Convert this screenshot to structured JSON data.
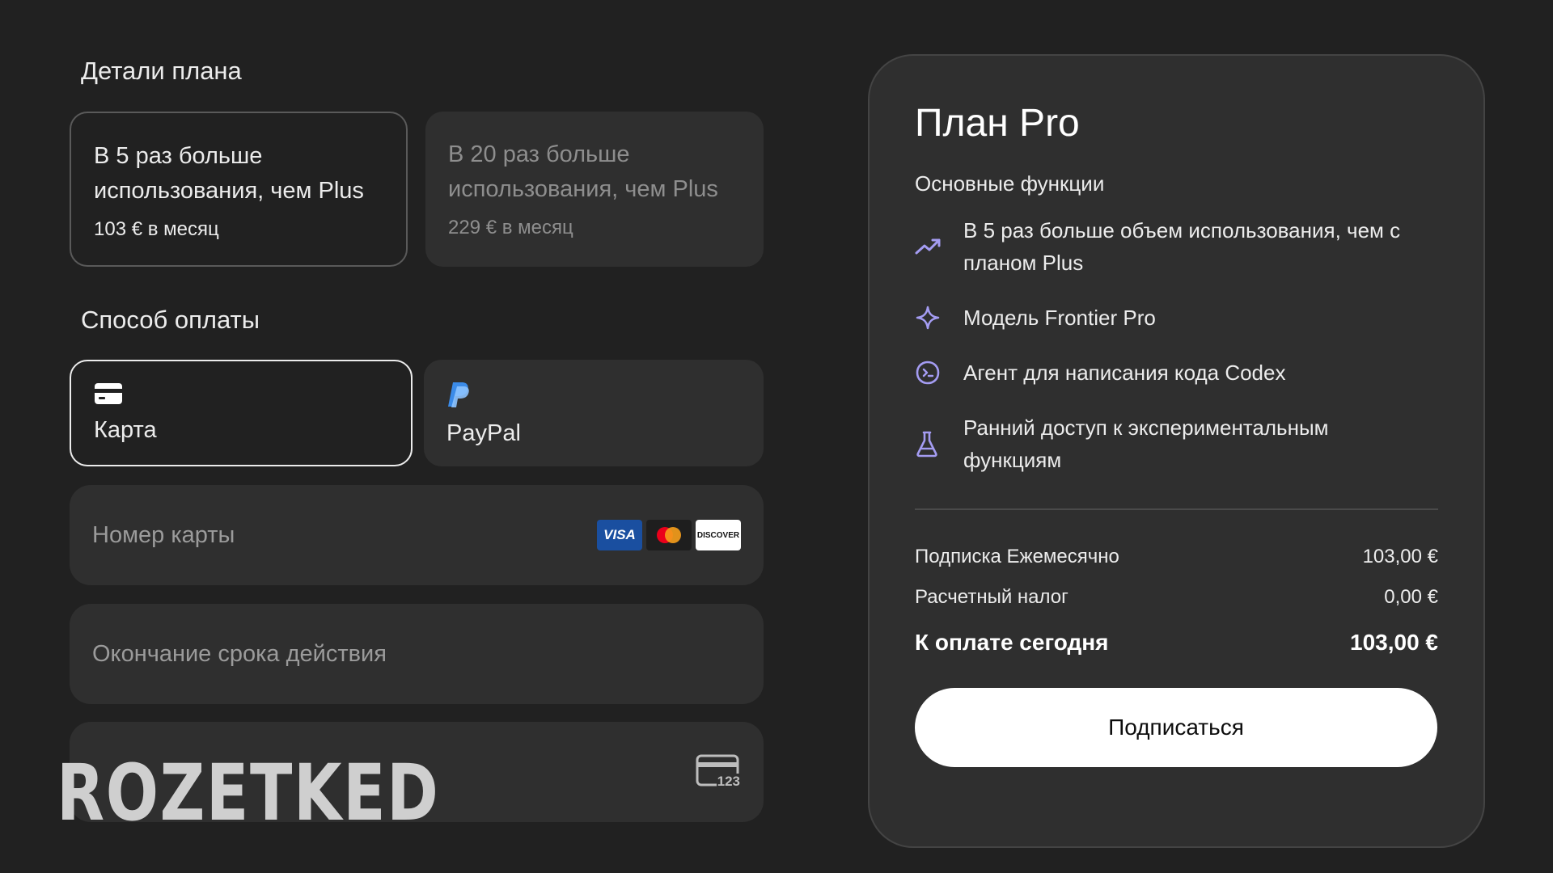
{
  "plan_details": {
    "heading": "Детали плана",
    "options": [
      {
        "title": "В 5 раз больше использования, чем Plus",
        "price": "103 € в месяц"
      },
      {
        "title": "В 20 раз больше использования, чем Plus",
        "price": "229 € в месяц"
      }
    ]
  },
  "payment": {
    "heading": "Способ оплаты",
    "methods": [
      {
        "label": "Карта",
        "icon": "credit-card-icon"
      },
      {
        "label": "PayPal",
        "icon": "paypal-icon"
      }
    ],
    "card_number_placeholder": "Номер карты",
    "expiry_placeholder": "Окончание срока действия",
    "cvc_placeholder": "",
    "brands": [
      "VISA",
      "DISCOVER"
    ],
    "cvc_icon_text": "123"
  },
  "watermark": "ROZETKED",
  "summary": {
    "title": "План Pro",
    "features_heading": "Основные функции",
    "features": [
      {
        "icon": "trend-up-icon",
        "text": "В 5 раз больше объем использования, чем с планом Plus"
      },
      {
        "icon": "sparkle-icon",
        "text": "Модель Frontier Pro"
      },
      {
        "icon": "codex-icon",
        "text": "Агент для написания кода Codex"
      },
      {
        "icon": "flask-icon",
        "text": "Ранний доступ к экспериментальным функциям"
      }
    ],
    "lines": [
      {
        "label": "Подписка Ежемесячно",
        "value": "103,00 €"
      },
      {
        "label": "Расчетный налог",
        "value": "0,00 €"
      }
    ],
    "total": {
      "label": "К оплате сегодня",
      "value": "103,00 €"
    },
    "subscribe_label": "Подписаться"
  },
  "colors": {
    "background": "#212121",
    "card": "#2f2f2f",
    "accent_icon": "#a49cf2",
    "visa": "#1a4fa0",
    "mastercard_red": "#eb001b",
    "mastercard_orange": "#f79e1b"
  }
}
